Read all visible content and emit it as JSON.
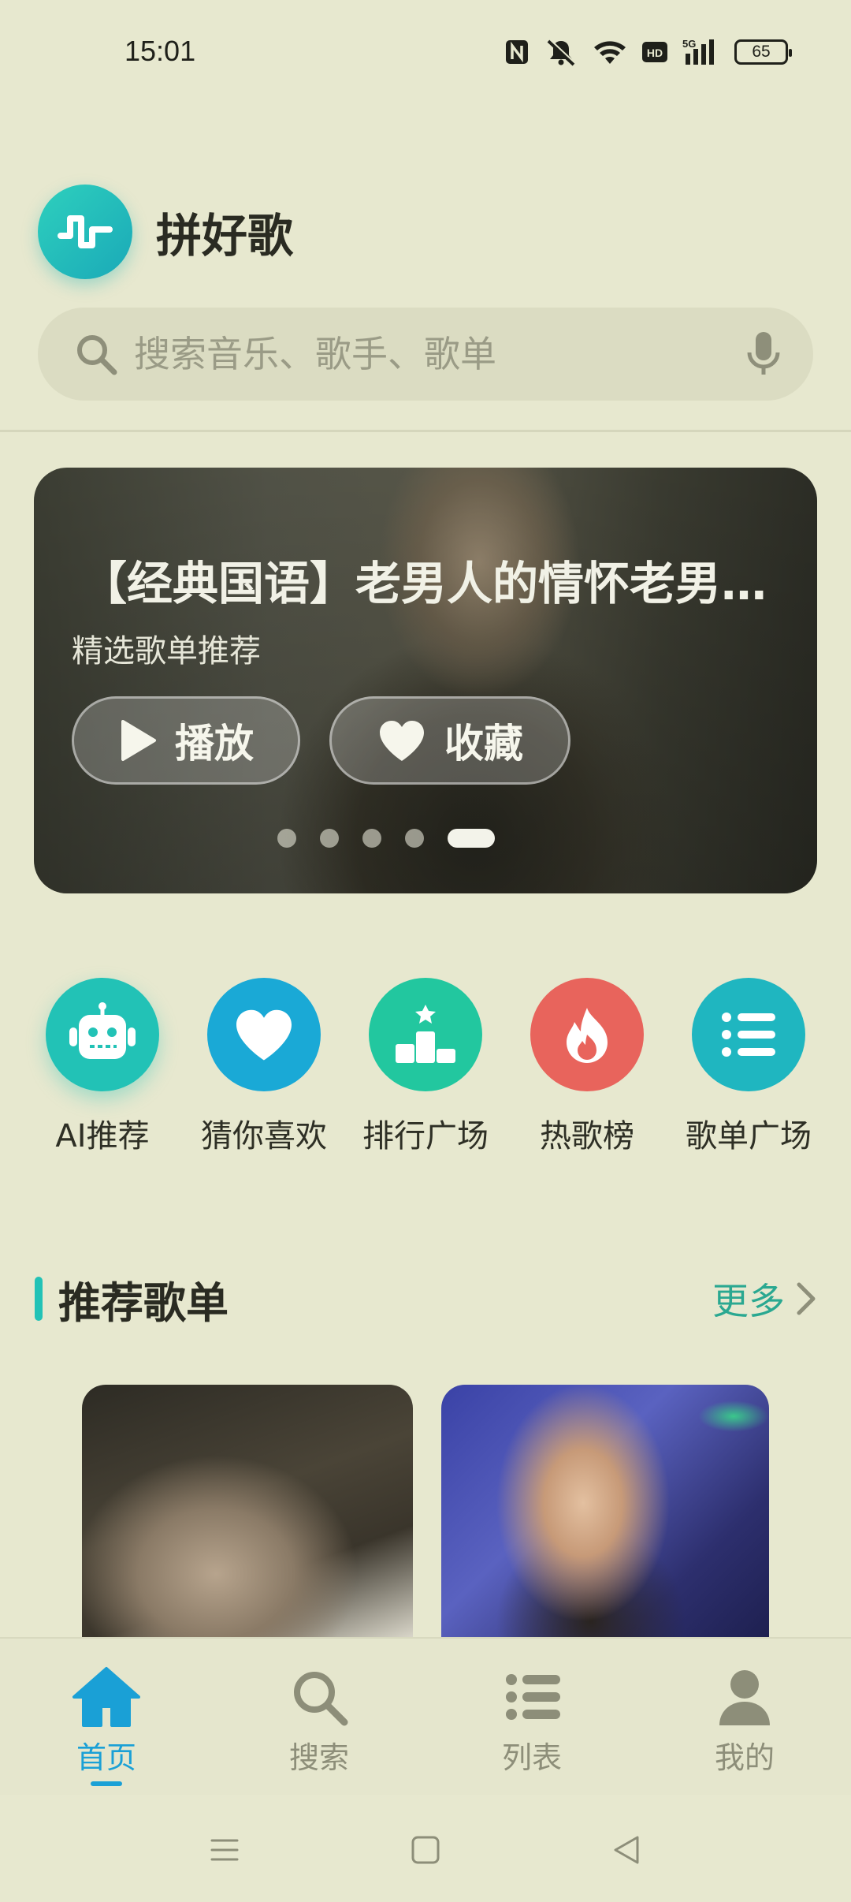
{
  "status_bar": {
    "time": "15:01",
    "battery": "65",
    "icons": [
      "nfc-icon",
      "mute-icon",
      "wifi-icon",
      "hd-icon",
      "5g-signal-icon",
      "battery-icon"
    ]
  },
  "header": {
    "app_name": "拼好歌",
    "logo_icon": "waveform-logo-icon"
  },
  "search": {
    "placeholder": "搜索音乐、歌手、歌单",
    "value": ""
  },
  "banner": {
    "title": "【经典国语】老男人的情怀老男人的情怀",
    "subtitle": "精选歌单推荐",
    "play_label": "播放",
    "favorite_label": "收藏",
    "slide_count": 5,
    "active_slide": 5
  },
  "quick_nav": [
    {
      "label": "AI推荐",
      "icon": "robot-icon",
      "color": "#22c2b6"
    },
    {
      "label": "猜你喜欢",
      "icon": "heart-icon",
      "color": "#1aa9d6"
    },
    {
      "label": "排行广场",
      "icon": "podium-icon",
      "color": "#22c79f"
    },
    {
      "label": "热歌榜",
      "icon": "flame-icon",
      "color": "#e8645c"
    },
    {
      "label": "歌单广场",
      "icon": "list-icon",
      "color": "#1fb6c0"
    }
  ],
  "recommended": {
    "title": "推荐歌单",
    "more_label": "更多"
  },
  "bottom_nav": [
    {
      "label": "首页",
      "icon": "home-icon",
      "active": true
    },
    {
      "label": "搜索",
      "icon": "search-icon",
      "active": false
    },
    {
      "label": "列表",
      "icon": "list-icon",
      "active": false
    },
    {
      "label": "我的",
      "icon": "user-icon",
      "active": false
    }
  ],
  "colors": {
    "background": "#e7e8cf",
    "accent": "#22c2b6",
    "active_tab": "#1aa0d6",
    "more_link": "#2aa891"
  }
}
